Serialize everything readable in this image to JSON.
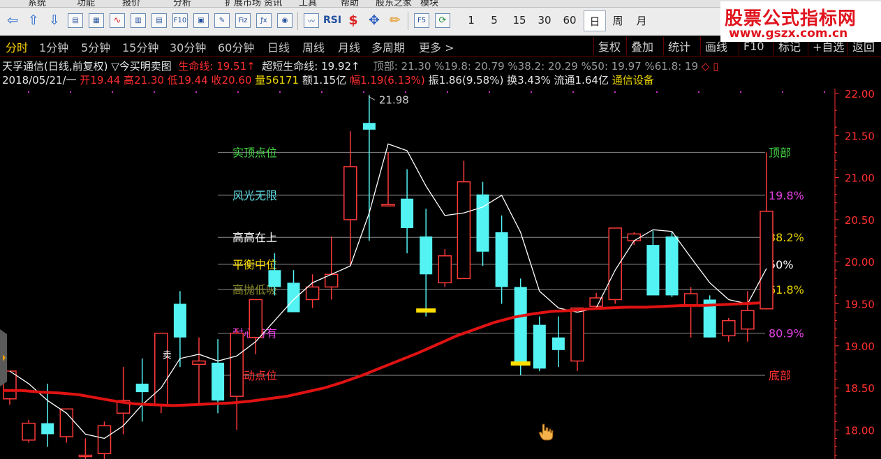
{
  "menu": [
    "系统",
    "功能",
    "报价",
    "分析",
    "扩展市场",
    "资讯",
    "工具",
    "帮助",
    "股东之家",
    "模块"
  ],
  "toolbar": {
    "icons": [
      "back-arrow-icon",
      "up-arrow-icon",
      "down-arrow-icon",
      "list-report-icon",
      "grid-table-icon",
      "trend-chart-icon",
      "candlestick-icon",
      "document-icon",
      "f10-icon",
      "folder-icon",
      "bookmark-icon",
      "formula-icon",
      "function-icon",
      "circle-select-icon",
      "index-wave-icon",
      "rsi-icon",
      "dollar-icon",
      "move-cross-icon",
      "pencil-icon",
      "f5-icon",
      "refresh-icon"
    ],
    "rsi_label": "RSI",
    "f5_label": "F5",
    "periods": [
      "1",
      "5",
      "15",
      "30",
      "60"
    ],
    "period_tabs": [
      "日",
      "周",
      "月"
    ],
    "active_period": "日"
  },
  "logo": {
    "main": "股票公式指标网",
    "url": "www.gszx.com.cn"
  },
  "period_tabs": [
    "分时",
    "1分钟",
    "5分钟",
    "15分钟",
    "30分钟",
    "60分钟",
    "日线",
    "周线",
    "月线",
    "多周期",
    "更多 >"
  ],
  "active_tab": "分时",
  "right_tabs": [
    "复权",
    "叠加",
    "统计",
    "画线",
    "F10",
    "标记",
    "+自选",
    "返回"
  ],
  "info": {
    "stock_line": "天孚通信(日线,前复权)",
    "indicator_name": "▽今买明卖图",
    "life_label": "生命线:",
    "life_value": "19.51↑",
    "ultra_label": "超短生命线:",
    "ultra_value": "19.92↑",
    "fib_text": "顶部: 21.30 %19.8: 20.79 %38.2: 20.29 %50: 19.97 %61.8: 19",
    "date": "2018/05/21/一",
    "open_label": "开",
    "open": "19.44",
    "high_label": "高",
    "high": "21.30",
    "low_label": "低",
    "low": "19.44",
    "close_label": "收",
    "close": "20.60",
    "vol_label": "量",
    "vol": "56171",
    "amount": "额1.15亿",
    "range_label": "幅",
    "range": "1.19(6.13%)",
    "amplitude": "振1.86(9.58%)",
    "turnover": "换3.43%",
    "float": "流通1.64亿",
    "industry": "通信设备"
  },
  "levels": [
    {
      "price": 21.3,
      "left_label": "实顶点位",
      "left_color": "#45d845",
      "right_label": "顶部",
      "right_color": "#45d845"
    },
    {
      "price": 20.79,
      "left_label": "风光无限",
      "left_color": "#5fe0e8",
      "right_label": "19.8%",
      "right_color": "#e040e0"
    },
    {
      "price": 20.29,
      "left_label": "高高在上",
      "left_color": "#ffffff",
      "right_label": "38.2%",
      "right_color": "#e8d200"
    },
    {
      "price": 19.97,
      "left_label": "平衡中位",
      "left_color": "#ffe000",
      "right_label": "50%",
      "right_color": "#ffffff"
    },
    {
      "price": 19.67,
      "left_label": "高抛低吸",
      "left_color": "#8a8a2a",
      "right_label": "61.8%",
      "right_color": "#e8d200"
    },
    {
      "price": 19.15,
      "left_label": "耐心持有",
      "left_color": "#e040e0",
      "right_label": "80.9%",
      "right_color": "#e040e0"
    },
    {
      "price": 18.65,
      "left_label": "启动点位",
      "left_color": "#ff3030",
      "right_label": "底部",
      "right_color": "#ff3030"
    }
  ],
  "chart_data": {
    "type": "candlestick",
    "ylim": [
      17.9,
      22.12
    ],
    "y_ticks": [
      "22.00",
      "21.50",
      "21.00",
      "20.50",
      "20.00",
      "19.50",
      "19.00",
      "18.50",
      "18.00"
    ],
    "y_tick_values": [
      22.0,
      21.5,
      21.0,
      20.5,
      20.0,
      19.5,
      19.0,
      18.5,
      18.0
    ],
    "peak_annotation": "21.98",
    "peak_value": 21.98,
    "candles": [
      {
        "o": 18.37,
        "h": 18.6,
        "l": 18.3,
        "c": 18.7
      },
      {
        "o": 17.88,
        "h": 18.12,
        "l": 17.85,
        "c": 18.08
      },
      {
        "o": 18.08,
        "h": 18.55,
        "l": 17.8,
        "c": 17.95
      },
      {
        "o": 17.92,
        "h": 18.25,
        "l": 17.85,
        "c": 18.25
      },
      {
        "o": 17.7,
        "h": 17.9,
        "l": 17.5,
        "c": 17.7
      },
      {
        "o": 17.72,
        "h": 18.1,
        "l": 17.55,
        "c": 18.05
      },
      {
        "o": 18.2,
        "h": 18.75,
        "l": 17.95,
        "c": 18.35
      },
      {
        "o": 18.55,
        "h": 18.85,
        "l": 18.1,
        "c": 18.45
      },
      {
        "o": 18.3,
        "h": 19.15,
        "l": 18.2,
        "c": 19.15
      },
      {
        "o": 19.5,
        "h": 19.65,
        "l": 18.75,
        "c": 19.1
      },
      {
        "o": 18.78,
        "h": 19.1,
        "l": 18.3,
        "c": 18.82
      },
      {
        "o": 18.8,
        "h": 19.08,
        "l": 18.2,
        "c": 18.35
      },
      {
        "o": 18.4,
        "h": 19.2,
        "l": 18.0,
        "c": 19.15
      },
      {
        "o": 19.1,
        "h": 19.55,
        "l": 18.9,
        "c": 19.55
      },
      {
        "o": 19.9,
        "h": 20.1,
        "l": 19.6,
        "c": 19.7
      },
      {
        "o": 19.75,
        "h": 19.9,
        "l": 19.45,
        "c": 19.4
      },
      {
        "o": 19.55,
        "h": 19.85,
        "l": 19.45,
        "c": 19.7
      },
      {
        "o": 19.7,
        "h": 20.3,
        "l": 19.55,
        "c": 19.85
      },
      {
        "o": 20.5,
        "h": 21.55,
        "l": 19.95,
        "c": 21.13
      },
      {
        "o": 21.65,
        "h": 21.98,
        "l": 20.25,
        "c": 21.57
      },
      {
        "o": 20.68,
        "h": 21.3,
        "l": 20.68,
        "c": 20.68
      },
      {
        "o": 20.75,
        "h": 21.1,
        "l": 20.1,
        "c": 20.4
      },
      {
        "o": 20.3,
        "h": 20.63,
        "l": 19.35,
        "c": 19.85
      },
      {
        "o": 19.75,
        "h": 20.15,
        "l": 19.7,
        "c": 20.07
      },
      {
        "o": 19.8,
        "h": 21.2,
        "l": 19.8,
        "c": 20.95
      },
      {
        "o": 20.8,
        "h": 20.95,
        "l": 19.95,
        "c": 20.12
      },
      {
        "o": 20.35,
        "h": 20.55,
        "l": 19.5,
        "c": 19.7
      },
      {
        "o": 19.7,
        "h": 19.8,
        "l": 18.65,
        "c": 18.78
      },
      {
        "o": 19.25,
        "h": 19.35,
        "l": 18.7,
        "c": 18.73
      },
      {
        "o": 19.1,
        "h": 19.35,
        "l": 18.75,
        "c": 18.95
      },
      {
        "o": 18.82,
        "h": 19.45,
        "l": 18.7,
        "c": 19.45
      },
      {
        "o": 19.47,
        "h": 19.63,
        "l": 19.45,
        "c": 19.57
      },
      {
        "o": 19.55,
        "h": 20.05,
        "l": 19.5,
        "c": 20.4
      },
      {
        "o": 20.25,
        "h": 20.35,
        "l": 20.2,
        "c": 20.33
      },
      {
        "o": 20.2,
        "h": 20.37,
        "l": 19.62,
        "c": 19.6
      },
      {
        "o": 20.3,
        "h": 20.35,
        "l": 19.58,
        "c": 19.6
      },
      {
        "o": 19.48,
        "h": 19.7,
        "l": 19.1,
        "c": 19.62
      },
      {
        "o": 19.55,
        "h": 19.6,
        "l": 19.1,
        "c": 19.1
      },
      {
        "o": 19.12,
        "h": 19.33,
        "l": 19.05,
        "c": 19.3
      },
      {
        "o": 19.2,
        "h": 19.65,
        "l": 19.05,
        "c": 19.42
      },
      {
        "o": 19.44,
        "h": 21.3,
        "l": 19.44,
        "c": 20.6
      }
    ],
    "markers": [
      {
        "index": 22,
        "value": 19.42,
        "color": "#ffe000"
      },
      {
        "index": 27,
        "value": 18.79,
        "color": "#ffe000"
      }
    ],
    "candle_label": {
      "index": 8,
      "text": "卖"
    },
    "ultra_short_line": [
      18.7,
      18.55,
      18.35,
      18.2,
      17.95,
      17.9,
      18.05,
      18.3,
      18.5,
      18.85,
      18.9,
      18.82,
      18.88,
      19.05,
      19.3,
      19.55,
      19.75,
      19.85,
      19.95,
      20.58,
      21.4,
      21.32,
      20.9,
      20.55,
      20.58,
      20.65,
      20.79,
      20.35,
      19.65,
      19.45,
      19.4,
      19.45,
      19.9,
      20.25,
      20.38,
      20.36,
      20.05,
      19.75,
      19.55,
      19.5,
      19.92
    ],
    "life_line": [
      18.47,
      18.47,
      18.45,
      18.44,
      18.42,
      18.38,
      18.34,
      18.31,
      18.3,
      18.29,
      18.3,
      18.31,
      18.32,
      18.34,
      18.37,
      18.4,
      18.45,
      18.5,
      18.57,
      18.65,
      18.74,
      18.83,
      18.92,
      19.02,
      19.12,
      19.2,
      19.28,
      19.34,
      19.38,
      19.41,
      19.42,
      19.44,
      19.45,
      19.46,
      19.46,
      19.47,
      19.48,
      19.48,
      19.49,
      19.5,
      19.51
    ],
    "colors": {
      "up": "#ff3a3a",
      "down": "#54f3f3",
      "ultra_line": "#ffffff",
      "life_line": "#e01212",
      "grid": "#8c8c8c",
      "axis": "#ff3030"
    }
  },
  "cursor": "hand-pointer-icon"
}
